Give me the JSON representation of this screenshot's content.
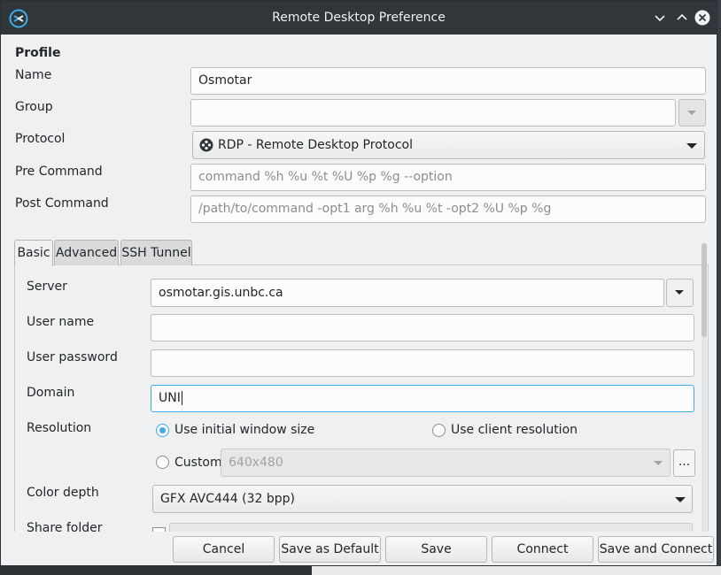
{
  "window": {
    "title": "Remote Desktop Preference",
    "app_icon": "remmina-icon"
  },
  "profile": {
    "heading": "Profile",
    "name_label": "Name",
    "name_value": "Osmotar",
    "group_label": "Group",
    "group_value": "",
    "protocol_label": "Protocol",
    "protocol_value": "RDP - Remote Desktop Protocol",
    "pre_command_label": "Pre Command",
    "pre_command_placeholder": "command %h %u %t %U %p %g --option",
    "post_command_label": "Post Command",
    "post_command_placeholder": "/path/to/command -opt1 arg %h %u %t -opt2 %U %p %g"
  },
  "tabs": [
    {
      "label": "Basic",
      "active": true
    },
    {
      "label": "Advanced",
      "active": false
    },
    {
      "label": "SSH Tunnel",
      "active": false
    }
  ],
  "basic": {
    "server_label": "Server",
    "server_value": "osmotar.gis.unbc.ca",
    "username_label": "User name",
    "username_value": "",
    "password_label": "User password",
    "password_value": "",
    "domain_label": "Domain",
    "domain_value": "UNI",
    "resolution_label": "Resolution",
    "res_initial_label": "Use initial window size",
    "res_client_label": "Use client resolution",
    "res_custom_label": "Custom",
    "res_custom_value": "640x480",
    "res_selected": "Use initial window size",
    "res_more_label": "...",
    "color_depth_label": "Color depth",
    "color_depth_value": "GFX AVC444 (32 bpp)",
    "share_folder_label": "Share folder"
  },
  "footer": {
    "cancel": "Cancel",
    "save_default": "Save as Default",
    "save": "Save",
    "connect": "Connect",
    "save_connect": "Save and Connect"
  },
  "colors": {
    "titlebar": "#31363b",
    "window_bg": "#eff0f1",
    "accent": "#3daee9"
  }
}
